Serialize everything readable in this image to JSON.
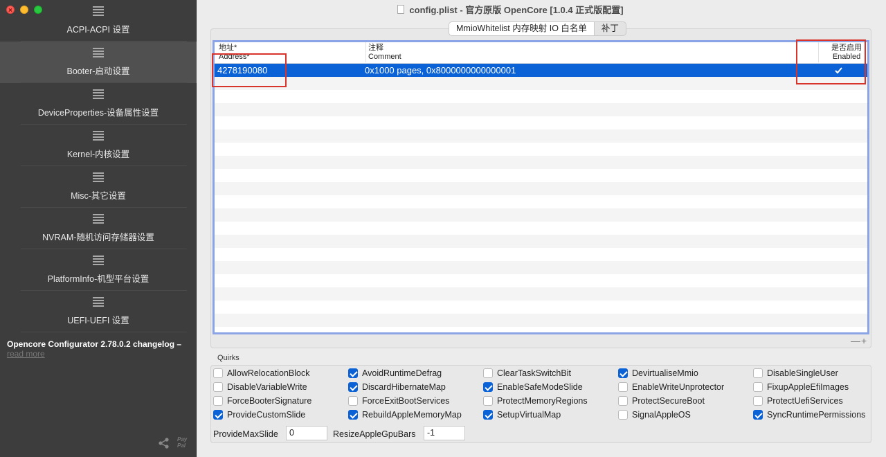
{
  "window": {
    "title": "config.plist - 官方原版 OpenCore [1.0.4 正式版配置]"
  },
  "sidebar": {
    "items": [
      {
        "label": "ACPI-ACPI 设置",
        "active": false
      },
      {
        "label": "Booter-启动设置",
        "active": true
      },
      {
        "label": "DeviceProperties-设备属性设置",
        "active": false
      },
      {
        "label": "Kernel-内核设置",
        "active": false
      },
      {
        "label": "Misc-其它设置",
        "active": false
      },
      {
        "label": "NVRAM-随机访问存储器设置",
        "active": false
      },
      {
        "label": "PlatformInfo-机型平台设置",
        "active": false
      },
      {
        "label": "UEFI-UEFI 设置",
        "active": false
      }
    ],
    "changelog": "Opencore Configurator 2.78.0.2 changelog –",
    "read_more": "read more",
    "paypal_line1": "Pay",
    "paypal_line2": "Pal"
  },
  "tabs": [
    {
      "label": "MmioWhitelist 内存映射 IO 白名单",
      "active": true
    },
    {
      "label": "补丁",
      "active": false
    }
  ],
  "table": {
    "headers": {
      "address_cn": "地址*",
      "address_en": "Address*",
      "comment_cn": "注释",
      "comment_en": "Comment",
      "enabled_cn": "是否启用",
      "enabled_en": "Enabled"
    },
    "rows": [
      {
        "address": "4278190080",
        "comment": "0x1000 pages, 0x8000000000000001",
        "enabled": true
      }
    ],
    "add_remove": "—+"
  },
  "quirks": {
    "label": "Quirks",
    "items": [
      {
        "label": "AllowRelocationBlock",
        "checked": false
      },
      {
        "label": "AvoidRuntimeDefrag",
        "checked": true
      },
      {
        "label": "ClearTaskSwitchBit",
        "checked": false
      },
      {
        "label": "DevirtualiseMmio",
        "checked": true
      },
      {
        "label": "DisableSingleUser",
        "checked": false
      },
      {
        "label": "DisableVariableWrite",
        "checked": false
      },
      {
        "label": "DiscardHibernateMap",
        "checked": true
      },
      {
        "label": "EnableSafeModeSlide",
        "checked": true
      },
      {
        "label": "EnableWriteUnprotector",
        "checked": false
      },
      {
        "label": "FixupAppleEfiImages",
        "checked": false
      },
      {
        "label": "ForceBooterSignature",
        "checked": false
      },
      {
        "label": "ForceExitBootServices",
        "checked": false
      },
      {
        "label": "ProtectMemoryRegions",
        "checked": false
      },
      {
        "label": "ProtectSecureBoot",
        "checked": false
      },
      {
        "label": "ProtectUefiServices",
        "checked": false
      },
      {
        "label": "ProvideCustomSlide",
        "checked": true
      },
      {
        "label": "RebuildAppleMemoryMap",
        "checked": true
      },
      {
        "label": "SetupVirtualMap",
        "checked": true
      },
      {
        "label": "SignalAppleOS",
        "checked": false
      },
      {
        "label": "SyncRuntimePermissions",
        "checked": true
      }
    ],
    "provide_max_slide_label": "ProvideMaxSlide",
    "provide_max_slide_value": "0",
    "resize_gpu_bars_label": "ResizeAppleGpuBars",
    "resize_gpu_bars_value": "-1"
  },
  "colors": {
    "accent": "#0a62d6",
    "sidebar_bg": "#3d3d3d",
    "highlight_box": "#d9342b",
    "table_focus": "#8aa4e6"
  }
}
